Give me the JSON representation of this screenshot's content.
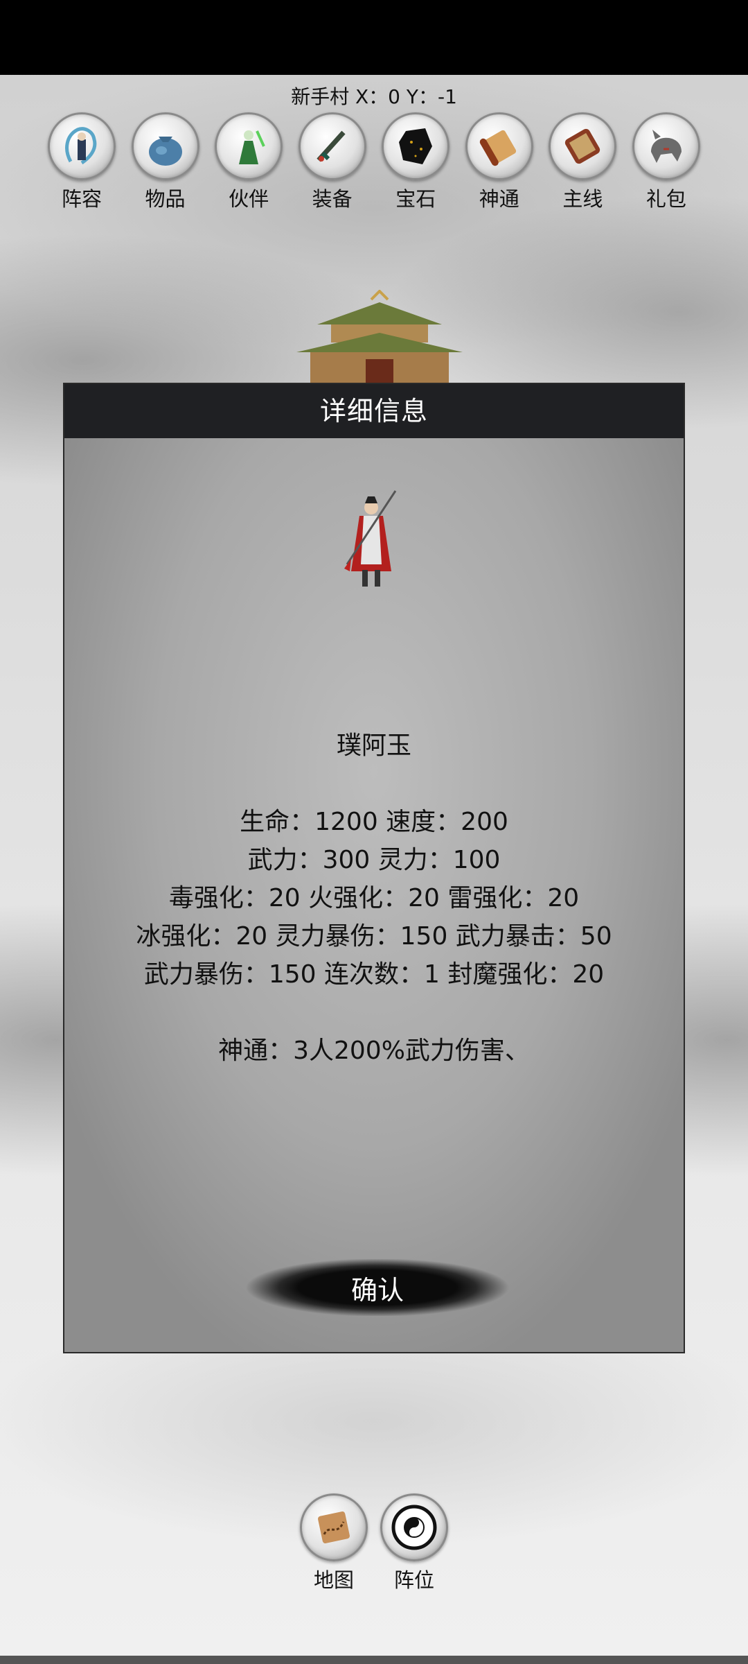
{
  "location": "新手村 X：0 Y：-1",
  "menu": [
    {
      "label": "阵容",
      "icon": "dragon-warrior-icon"
    },
    {
      "label": "物品",
      "icon": "bag-icon"
    },
    {
      "label": "伙伴",
      "icon": "green-warrior-icon"
    },
    {
      "label": "装备",
      "icon": "sword-icon"
    },
    {
      "label": "宝石",
      "icon": "gem-icon"
    },
    {
      "label": "神通",
      "icon": "scroll-icon"
    },
    {
      "label": "主线",
      "icon": "bamboo-scroll-icon"
    },
    {
      "label": "礼包",
      "icon": "wolf-icon"
    }
  ],
  "dialog": {
    "title": "详细信息",
    "name": "璞阿玉",
    "stats": [
      "生命：1200  速度：200",
      "武力：300  灵力：100",
      "毒强化：20 火强化：20 雷强化：20",
      "冰强化：20 灵力暴伤：150 武力暴击：50",
      "武力暴伤：150 连次数：1 封魔强化：20"
    ],
    "skill": "神通：3人200%武力伤害、",
    "confirm": "确认"
  },
  "bottom_menu": [
    {
      "label": "地图",
      "icon": "map-icon"
    },
    {
      "label": "阵位",
      "icon": "bagua-icon"
    }
  ]
}
